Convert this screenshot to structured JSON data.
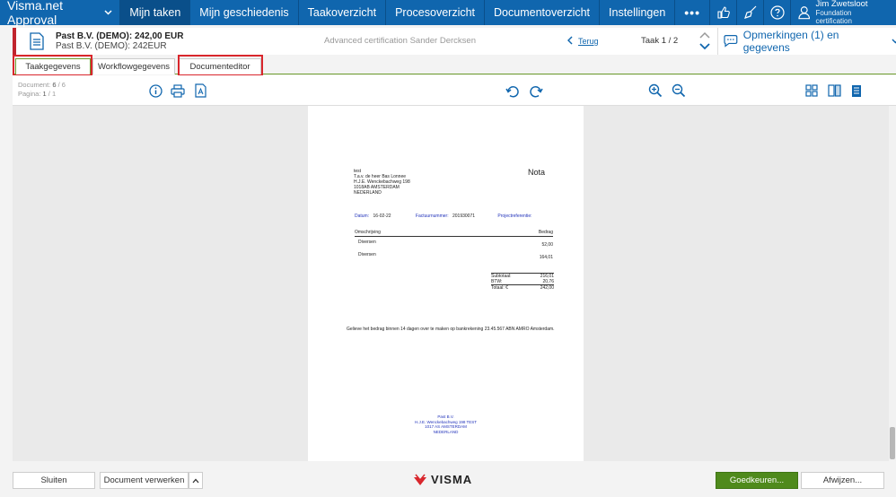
{
  "topbar": {
    "app_title": "Visma.net Approval",
    "nav": [
      "Mijn taken",
      "Mijn geschiedenis",
      "Taakoverzicht",
      "Procesoverzicht",
      "Documentoverzicht",
      "Instellingen"
    ],
    "active_index": 0,
    "more": "•••",
    "user_name": "Jim Zwetsloot",
    "user_role": "Foundation certification"
  },
  "task": {
    "title": "Past B.V. (DEMO): 242,00 EUR",
    "subtitle": "Past B.V. (DEMO): 242EUR",
    "certification": "Advanced certification Sander Dercksen",
    "back_label": "Terug",
    "page_info": "Taak 1 / 2",
    "remarks": "Opmerkingen (1) en gegevens"
  },
  "tabs": [
    "Taakgegevens",
    "Workflowgegevens",
    "Documenteditor"
  ],
  "viewer": {
    "doc_label": "Document:",
    "doc_current": "6",
    "doc_total": "/ 6",
    "page_label": "Pagina:",
    "page_current": "1",
    "page_total": "/ 1"
  },
  "document": {
    "address": [
      "test",
      "T.a.v. de heer Bas Lonnee",
      "H.J.E. Wenckebachweg 198",
      "1018AB AMSTERDAM",
      "NEDERLAND"
    ],
    "heading": "Nota",
    "date_label": "Datum:",
    "date_value": "16-02-22",
    "invoice_label": "Factuurnummer:",
    "invoice_value": "201930071",
    "project_label": "Projectreferentie:",
    "col_description": "Omschrijving",
    "col_amount": "Bedrag",
    "lines": [
      {
        "desc": "Diversen",
        "amount": "52,00"
      },
      {
        "desc": "Diversen",
        "amount": "164,01"
      }
    ],
    "subtotal_label": "Subtotaal:",
    "subtotal_value": "216,01",
    "vat_label": "BTW:",
    "vat_value": "20,76",
    "total_label": "Totaal: €",
    "total_value": "242,00",
    "note": "Gelieve het bedrag binnen 14 dagen over te maken op bankrekening 23.45.567 ABN AMRO Amsterdam.",
    "footer": [
      "Past B.V.",
      "H.J.E. Wenckebachweg 198 TEST",
      "1017 AS AMSTERDAM",
      "NEDERLAND"
    ]
  },
  "bottom": {
    "close": "Sluiten",
    "process": "Document verwerken",
    "brand": "VISMA",
    "approve": "Goedkeuren...",
    "reject": "Afwijzen..."
  },
  "colors": {
    "nav_blue": "#1066ae",
    "accent_red": "#c0242d",
    "approve_green": "#4f8a1c",
    "tab_green": "#6e9d2d"
  }
}
